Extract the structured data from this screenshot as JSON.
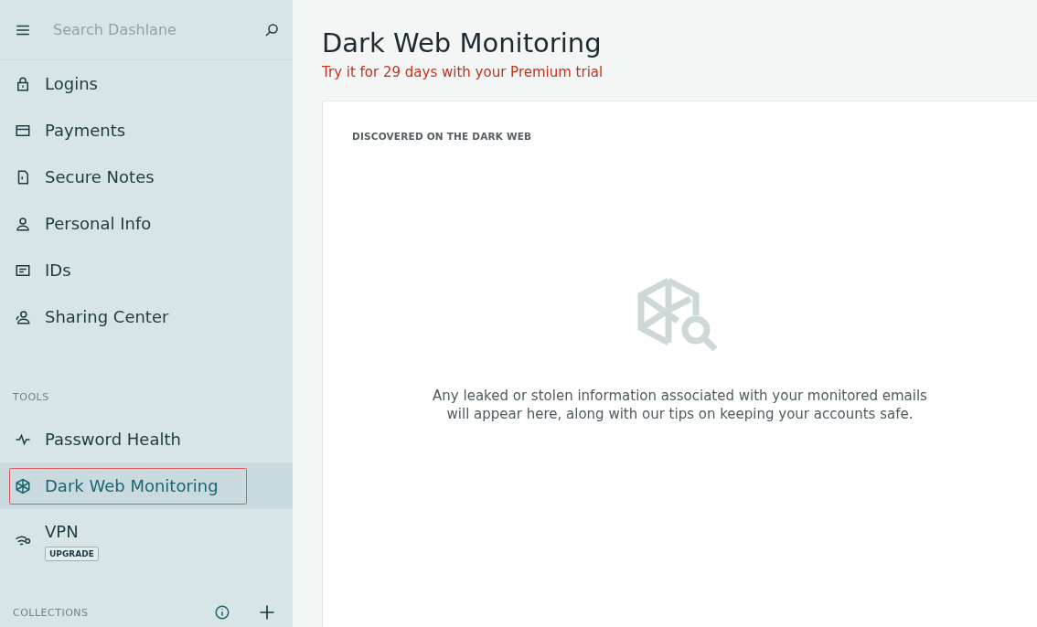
{
  "search": {
    "placeholder": "Search Dashlane"
  },
  "nav_items": [
    {
      "label": "Logins",
      "selected": false
    },
    {
      "label": "Payments",
      "selected": false
    },
    {
      "label": "Secure Notes",
      "selected": false
    },
    {
      "label": "Personal Info",
      "selected": false
    },
    {
      "label": "IDs",
      "selected": false
    },
    {
      "label": "Sharing Center",
      "selected": false
    }
  ],
  "tools": {
    "heading": "TOOLS",
    "items": [
      {
        "label": "Password Health",
        "selected": false,
        "highlighted": false
      },
      {
        "label": "Dark Web Monitoring",
        "selected": true,
        "highlighted": true
      },
      {
        "label": "VPN",
        "selected": false,
        "highlighted": false,
        "badge": "UPGRADE"
      }
    ]
  },
  "collections": {
    "heading": "COLLECTIONS"
  },
  "page": {
    "title": "Dark Web Monitoring",
    "subtitle": "Try it for 29 days with your Premium trial"
  },
  "card": {
    "heading": "DISCOVERED ON THE DARK WEB",
    "empty_message": "Any leaked or stolen information associated with your monitored emails will appear here, along with our tips on keeping your accounts safe."
  }
}
